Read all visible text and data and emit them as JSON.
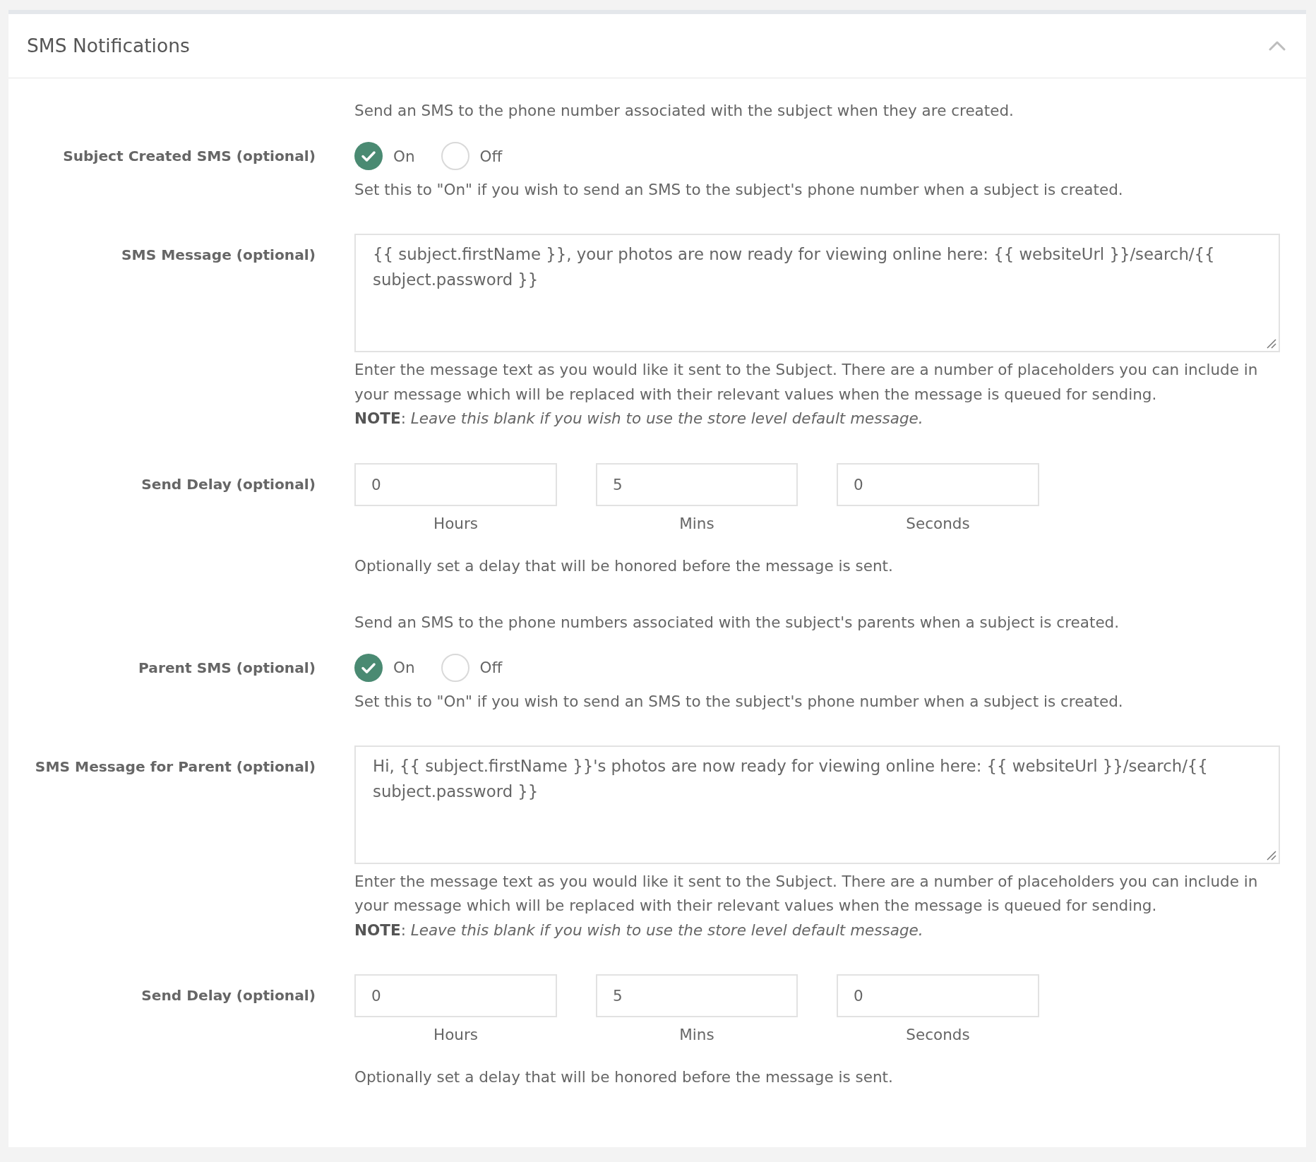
{
  "panel": {
    "title": "SMS Notifications",
    "expanded": true
  },
  "sections": [
    {
      "description": "Send an SMS to the phone number associated with the subject when they are created.",
      "toggle": {
        "label": "Subject Created SMS (optional)",
        "options": [
          {
            "label": "On",
            "selected": true
          },
          {
            "label": "Off",
            "selected": false
          }
        ],
        "help": "Set this to \"On\" if you wish to send an SMS to the subject's phone number when a subject is created."
      },
      "message": {
        "label": "SMS Message (optional)",
        "value": "{{ subject.firstName }}, your photos are now ready for viewing online here: {{ websiteUrl }}/search/{{ subject.password }}",
        "help": "Enter the message text as you would like it sent to the Subject. There are a number of placeholders you can include in your message which will be replaced with their relevant values when the message is queued for sending.",
        "note": "**NOTE**: *Leave this blank if you wish to use the store level default message.*"
      },
      "delay": {
        "label": "Send Delay (optional)",
        "fields": [
          {
            "value": "0",
            "caption": "Hours"
          },
          {
            "value": "5",
            "caption": "Mins"
          },
          {
            "value": "0",
            "caption": "Seconds"
          }
        ],
        "help": "Optionally set a delay that will be honored before the message is sent."
      }
    },
    {
      "description": "Send an SMS to the phone numbers associated with the subject's parents when a subject is created.",
      "toggle": {
        "label": "Parent SMS (optional)",
        "options": [
          {
            "label": "On",
            "selected": true
          },
          {
            "label": "Off",
            "selected": false
          }
        ],
        "help": "Set this to \"On\" if you wish to send an SMS to the subject's phone number when a subject is created."
      },
      "message": {
        "label": "SMS Message for Parent (optional)",
        "value": "Hi, {{ subject.firstName }}'s photos are now ready for viewing online here: {{ websiteUrl }}/search/{{ subject.password }}",
        "help": "Enter the message text as you would like it sent to the Subject. There are a number of placeholders you can include in your message which will be replaced with their relevant values when the message is queued for sending.",
        "note": "**NOTE**: *Leave this blank if you wish to use the store level default message.*"
      },
      "delay": {
        "label": "Send Delay (optional)",
        "fields": [
          {
            "value": "0",
            "caption": "Hours"
          },
          {
            "value": "5",
            "caption": "Mins"
          },
          {
            "value": "0",
            "caption": "Seconds"
          }
        ],
        "help": "Optionally set a delay that will be honored before the message is sent."
      }
    }
  ]
}
